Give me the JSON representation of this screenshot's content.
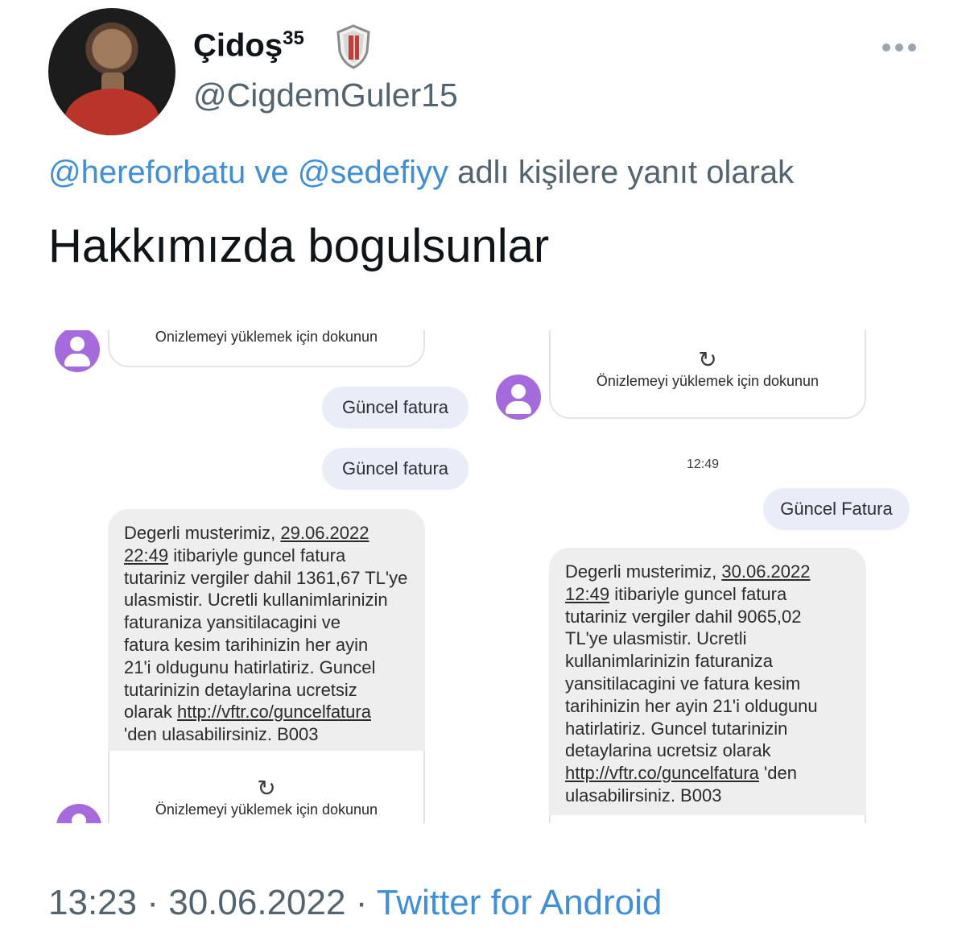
{
  "tweet": {
    "display_name": "Çidoş",
    "display_name_sup": "35",
    "handle": "@CigdemGuler15",
    "reply": {
      "mention1": "@hereforbatu",
      "joiner": "ve",
      "mention2": "@sedefiyy",
      "suffix": "adlı kişilere yanıt olarak"
    },
    "text": "Hakkımızda bogulsunlar",
    "time": "13:23",
    "date": "30.06.2022",
    "separator": "·",
    "source": "Twitter for Android"
  },
  "icons": {
    "badge": "shield-badge-icon",
    "more": "more-options-icon",
    "refresh": "refresh-icon",
    "contact": "contact-avatar-icon"
  },
  "colors": {
    "link": "#3e8ed8",
    "secondary_text": "#536471",
    "sms_avatar": "#a56bdc",
    "bubble_out": "#e8edf8",
    "bubble_in": "#eeeeee"
  },
  "screenshot_left": {
    "preview_top_text": "Önizlemeyi yüklemek için dokunun",
    "outgoing1": "Güncel fatura",
    "outgoing2": "Güncel fatura",
    "sms": {
      "l1a": "Degerli musterimiz,",
      "l1b": "29.06.2022",
      "l2a": "22:49",
      "l2b": "itibariyle guncel fatura",
      "l3": "tutariniz vergiler dahil 1361,67 TL'ye",
      "l4": "ulasmistir. Ucretli kullanimlarinizin",
      "l5": "faturaniza yansitilacagini ve",
      "l6": "fatura kesim tarihinizin her ayin",
      "l7": "21'i oldugunu hatirlatiriz. Guncel",
      "l8": "tutarinizin detaylarina ucretsiz",
      "l9a": "olarak",
      "l9b": "http://vftr.co/guncelfatura",
      "l10": "'den ulasabilirsiniz. B003"
    },
    "preview_bottom_text": "Önizlemeyi yüklemek için dokunun"
  },
  "screenshot_right": {
    "preview_text": "Önizlemeyi yüklemek için dokunun",
    "time": "12:49",
    "outgoing": "Güncel Fatura",
    "sms": {
      "l1a": "Degerli musterimiz,",
      "l1b": "30.06.2022",
      "l2a": "12:49",
      "l2b": "itibariyle guncel fatura",
      "l3": "tutariniz vergiler dahil 9065,02",
      "l4": "TL'ye ulasmistir. Ucretli",
      "l5": "kullanimlarinizin faturaniza",
      "l6": "yansitilacagini ve fatura kesim",
      "l7": "tarihinizin her ayin 21'i oldugunu",
      "l8": "hatirlatiriz. Guncel tutarinizin",
      "l9": "detaylarina ucretsiz olarak",
      "l10a": "http://vftr.co/guncelfatura",
      "l10b": "'den",
      "l11": "ulasabilirsiniz. B003"
    }
  }
}
